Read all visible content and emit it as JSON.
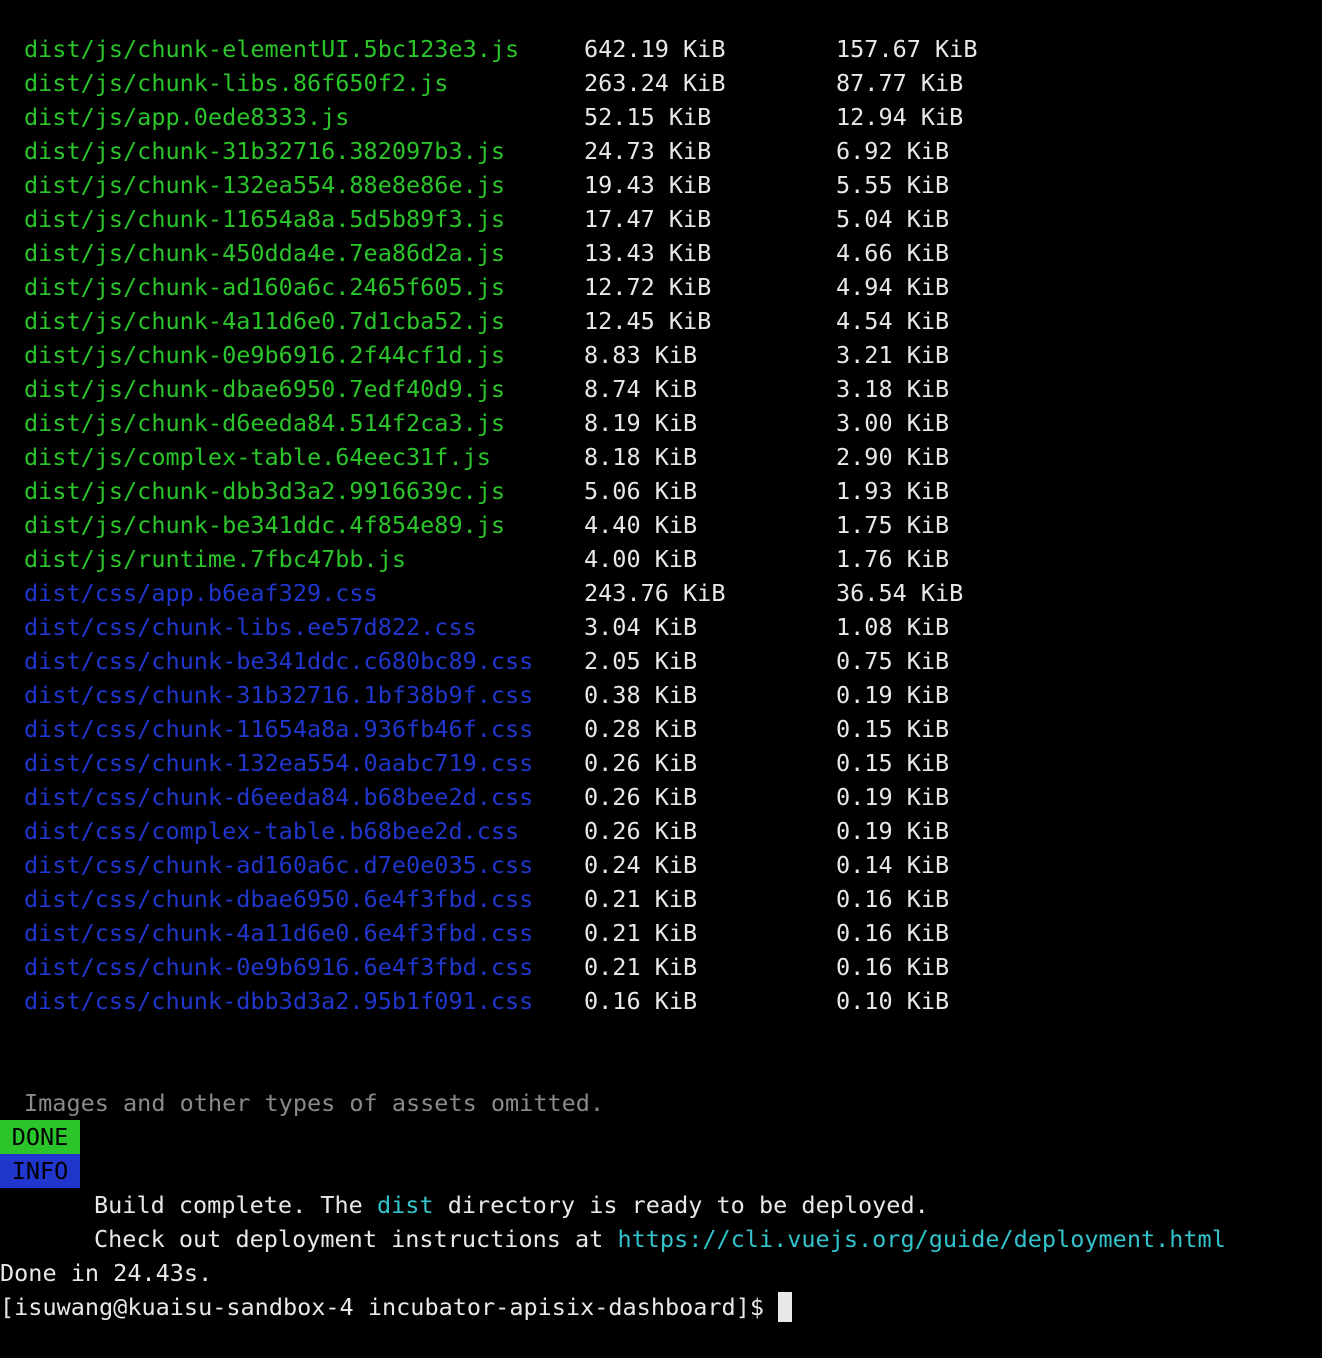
{
  "colors": {
    "js_asset": "#2bc42b",
    "css_asset": "#2036cc",
    "done_badge": "#2bc42b",
    "info_badge": "#2036cc",
    "link": "#33c3cc",
    "note": "#8a8a8a"
  },
  "assets": [
    {
      "file": "dist/js/chunk-elementUI.5bc123e3.js",
      "size": "642.19 KiB",
      "gzipped": "157.67 KiB",
      "kind": "js"
    },
    {
      "file": "dist/js/chunk-libs.86f650f2.js",
      "size": "263.24 KiB",
      "gzipped": "87.77 KiB",
      "kind": "js"
    },
    {
      "file": "dist/js/app.0ede8333.js",
      "size": "52.15 KiB",
      "gzipped": "12.94 KiB",
      "kind": "js"
    },
    {
      "file": "dist/js/chunk-31b32716.382097b3.js",
      "size": "24.73 KiB",
      "gzipped": "6.92 KiB",
      "kind": "js"
    },
    {
      "file": "dist/js/chunk-132ea554.88e8e86e.js",
      "size": "19.43 KiB",
      "gzipped": "5.55 KiB",
      "kind": "js"
    },
    {
      "file": "dist/js/chunk-11654a8a.5d5b89f3.js",
      "size": "17.47 KiB",
      "gzipped": "5.04 KiB",
      "kind": "js"
    },
    {
      "file": "dist/js/chunk-450dda4e.7ea86d2a.js",
      "size": "13.43 KiB",
      "gzipped": "4.66 KiB",
      "kind": "js"
    },
    {
      "file": "dist/js/chunk-ad160a6c.2465f605.js",
      "size": "12.72 KiB",
      "gzipped": "4.94 KiB",
      "kind": "js"
    },
    {
      "file": "dist/js/chunk-4a11d6e0.7d1cba52.js",
      "size": "12.45 KiB",
      "gzipped": "4.54 KiB",
      "kind": "js"
    },
    {
      "file": "dist/js/chunk-0e9b6916.2f44cf1d.js",
      "size": "8.83 KiB",
      "gzipped": "3.21 KiB",
      "kind": "js"
    },
    {
      "file": "dist/js/chunk-dbae6950.7edf40d9.js",
      "size": "8.74 KiB",
      "gzipped": "3.18 KiB",
      "kind": "js"
    },
    {
      "file": "dist/js/chunk-d6eeda84.514f2ca3.js",
      "size": "8.19 KiB",
      "gzipped": "3.00 KiB",
      "kind": "js"
    },
    {
      "file": "dist/js/complex-table.64eec31f.js",
      "size": "8.18 KiB",
      "gzipped": "2.90 KiB",
      "kind": "js"
    },
    {
      "file": "dist/js/chunk-dbb3d3a2.9916639c.js",
      "size": "5.06 KiB",
      "gzipped": "1.93 KiB",
      "kind": "js"
    },
    {
      "file": "dist/js/chunk-be341ddc.4f854e89.js",
      "size": "4.40 KiB",
      "gzipped": "1.75 KiB",
      "kind": "js"
    },
    {
      "file": "dist/js/runtime.7fbc47bb.js",
      "size": "4.00 KiB",
      "gzipped": "1.76 KiB",
      "kind": "js"
    },
    {
      "file": "dist/css/app.b6eaf329.css",
      "size": "243.76 KiB",
      "gzipped": "36.54 KiB",
      "kind": "css"
    },
    {
      "file": "dist/css/chunk-libs.ee57d822.css",
      "size": "3.04 KiB",
      "gzipped": "1.08 KiB",
      "kind": "css"
    },
    {
      "file": "dist/css/chunk-be341ddc.c680bc89.css",
      "size": "2.05 KiB",
      "gzipped": "0.75 KiB",
      "kind": "css"
    },
    {
      "file": "dist/css/chunk-31b32716.1bf38b9f.css",
      "size": "0.38 KiB",
      "gzipped": "0.19 KiB",
      "kind": "css"
    },
    {
      "file": "dist/css/chunk-11654a8a.936fb46f.css",
      "size": "0.28 KiB",
      "gzipped": "0.15 KiB",
      "kind": "css"
    },
    {
      "file": "dist/css/chunk-132ea554.0aabc719.css",
      "size": "0.26 KiB",
      "gzipped": "0.15 KiB",
      "kind": "css"
    },
    {
      "file": "dist/css/chunk-d6eeda84.b68bee2d.css",
      "size": "0.26 KiB",
      "gzipped": "0.19 KiB",
      "kind": "css"
    },
    {
      "file": "dist/css/complex-table.b68bee2d.css",
      "size": "0.26 KiB",
      "gzipped": "0.19 KiB",
      "kind": "css"
    },
    {
      "file": "dist/css/chunk-ad160a6c.d7e0e035.css",
      "size": "0.24 KiB",
      "gzipped": "0.14 KiB",
      "kind": "css"
    },
    {
      "file": "dist/css/chunk-dbae6950.6e4f3fbd.css",
      "size": "0.21 KiB",
      "gzipped": "0.16 KiB",
      "kind": "css"
    },
    {
      "file": "dist/css/chunk-4a11d6e0.6e4f3fbd.css",
      "size": "0.21 KiB",
      "gzipped": "0.16 KiB",
      "kind": "css"
    },
    {
      "file": "dist/css/chunk-0e9b6916.6e4f3fbd.css",
      "size": "0.21 KiB",
      "gzipped": "0.16 KiB",
      "kind": "css"
    },
    {
      "file": "dist/css/chunk-dbb3d3a2.95b1f091.css",
      "size": "0.16 KiB",
      "gzipped": "0.10 KiB",
      "kind": "css"
    }
  ],
  "note": "Images and other types of assets omitted.",
  "done": {
    "badge": "DONE",
    "text_before": "Build complete. The ",
    "highlight": "dist",
    "text_after": " directory is ready to be deployed."
  },
  "info": {
    "badge": "INFO",
    "text": "Check out deployment instructions at ",
    "link": "https://cli.vuejs.org/guide/deployment.html"
  },
  "done_time": "Done in 24.43s.",
  "prompt": "[isuwang@kuaisu-sandbox-4 incubator-apisix-dashboard]$"
}
